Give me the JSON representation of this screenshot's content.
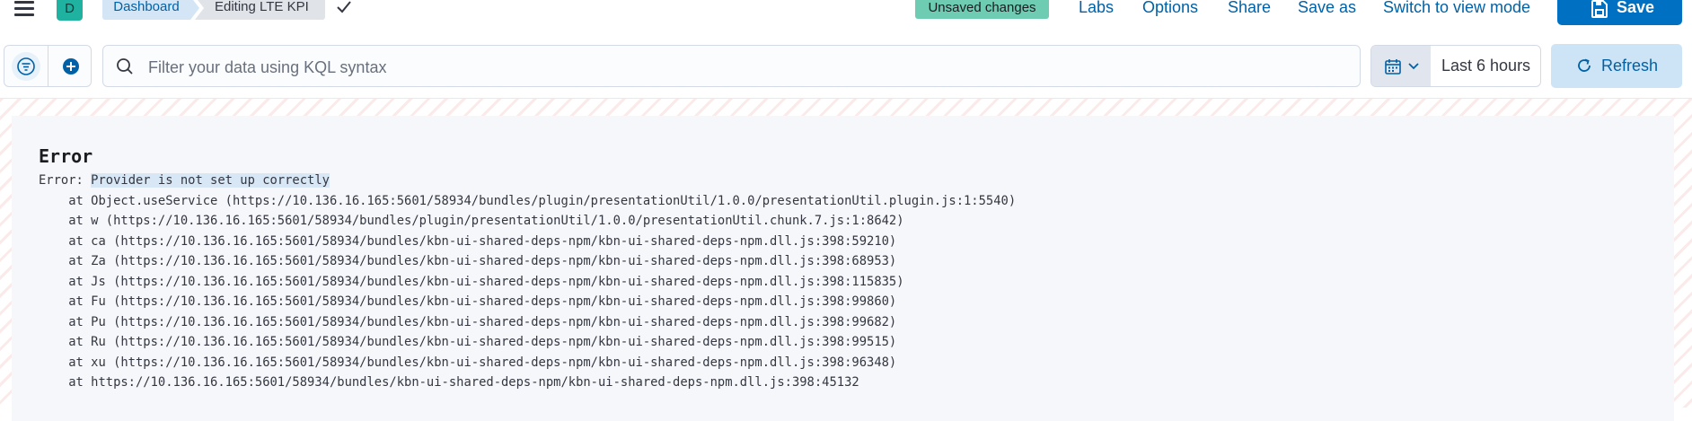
{
  "header": {
    "avatar_letter": "D",
    "breadcrumbs": [
      "Dashboard",
      "Editing LTE KPI"
    ],
    "unsaved_badge": "Unsaved changes",
    "links": [
      "Labs",
      "Options",
      "Share",
      "Save as",
      "Switch to view mode"
    ],
    "save_label": "Save"
  },
  "filter_bar": {
    "query_placeholder": "Filter your data using KQL syntax",
    "date_range": "Last 6 hours",
    "refresh_label": "Refresh"
  },
  "error_panel": {
    "title": "Error",
    "message_prefix": "Error: ",
    "message": "Provider is not set up correctly",
    "stack": [
      "    at Object.useService (https://10.136.16.165:5601/58934/bundles/plugin/presentationUtil/1.0.0/presentationUtil.plugin.js:1:5540)",
      "    at w (https://10.136.16.165:5601/58934/bundles/plugin/presentationUtil/1.0.0/presentationUtil.chunk.7.js:1:8642)",
      "    at ca (https://10.136.16.165:5601/58934/bundles/kbn-ui-shared-deps-npm/kbn-ui-shared-deps-npm.dll.js:398:59210)",
      "    at Za (https://10.136.16.165:5601/58934/bundles/kbn-ui-shared-deps-npm/kbn-ui-shared-deps-npm.dll.js:398:68953)",
      "    at Js (https://10.136.16.165:5601/58934/bundles/kbn-ui-shared-deps-npm/kbn-ui-shared-deps-npm.dll.js:398:115835)",
      "    at Fu (https://10.136.16.165:5601/58934/bundles/kbn-ui-shared-deps-npm/kbn-ui-shared-deps-npm.dll.js:398:99860)",
      "    at Pu (https://10.136.16.165:5601/58934/bundles/kbn-ui-shared-deps-npm/kbn-ui-shared-deps-npm.dll.js:398:99682)",
      "    at Ru (https://10.136.16.165:5601/58934/bundles/kbn-ui-shared-deps-npm/kbn-ui-shared-deps-npm.dll.js:398:99515)",
      "    at xu (https://10.136.16.165:5601/58934/bundles/kbn-ui-shared-deps-npm/kbn-ui-shared-deps-npm.dll.js:398:96348)",
      "    at https://10.136.16.165:5601/58934/bundles/kbn-ui-shared-deps-npm/kbn-ui-shared-deps-npm.dll.js:398:45132"
    ]
  },
  "icons": [
    "menu-icon",
    "checkmark-icon",
    "save-icon",
    "filter-menu-icon",
    "add-filter-icon",
    "search-icon",
    "calendar-icon",
    "chevron-down-icon",
    "refresh-icon"
  ],
  "colors": {
    "primary": "#0071c2",
    "link": "#0061a6",
    "unsaved_badge": "#6dccb1",
    "avatar": "#20b2a0"
  }
}
